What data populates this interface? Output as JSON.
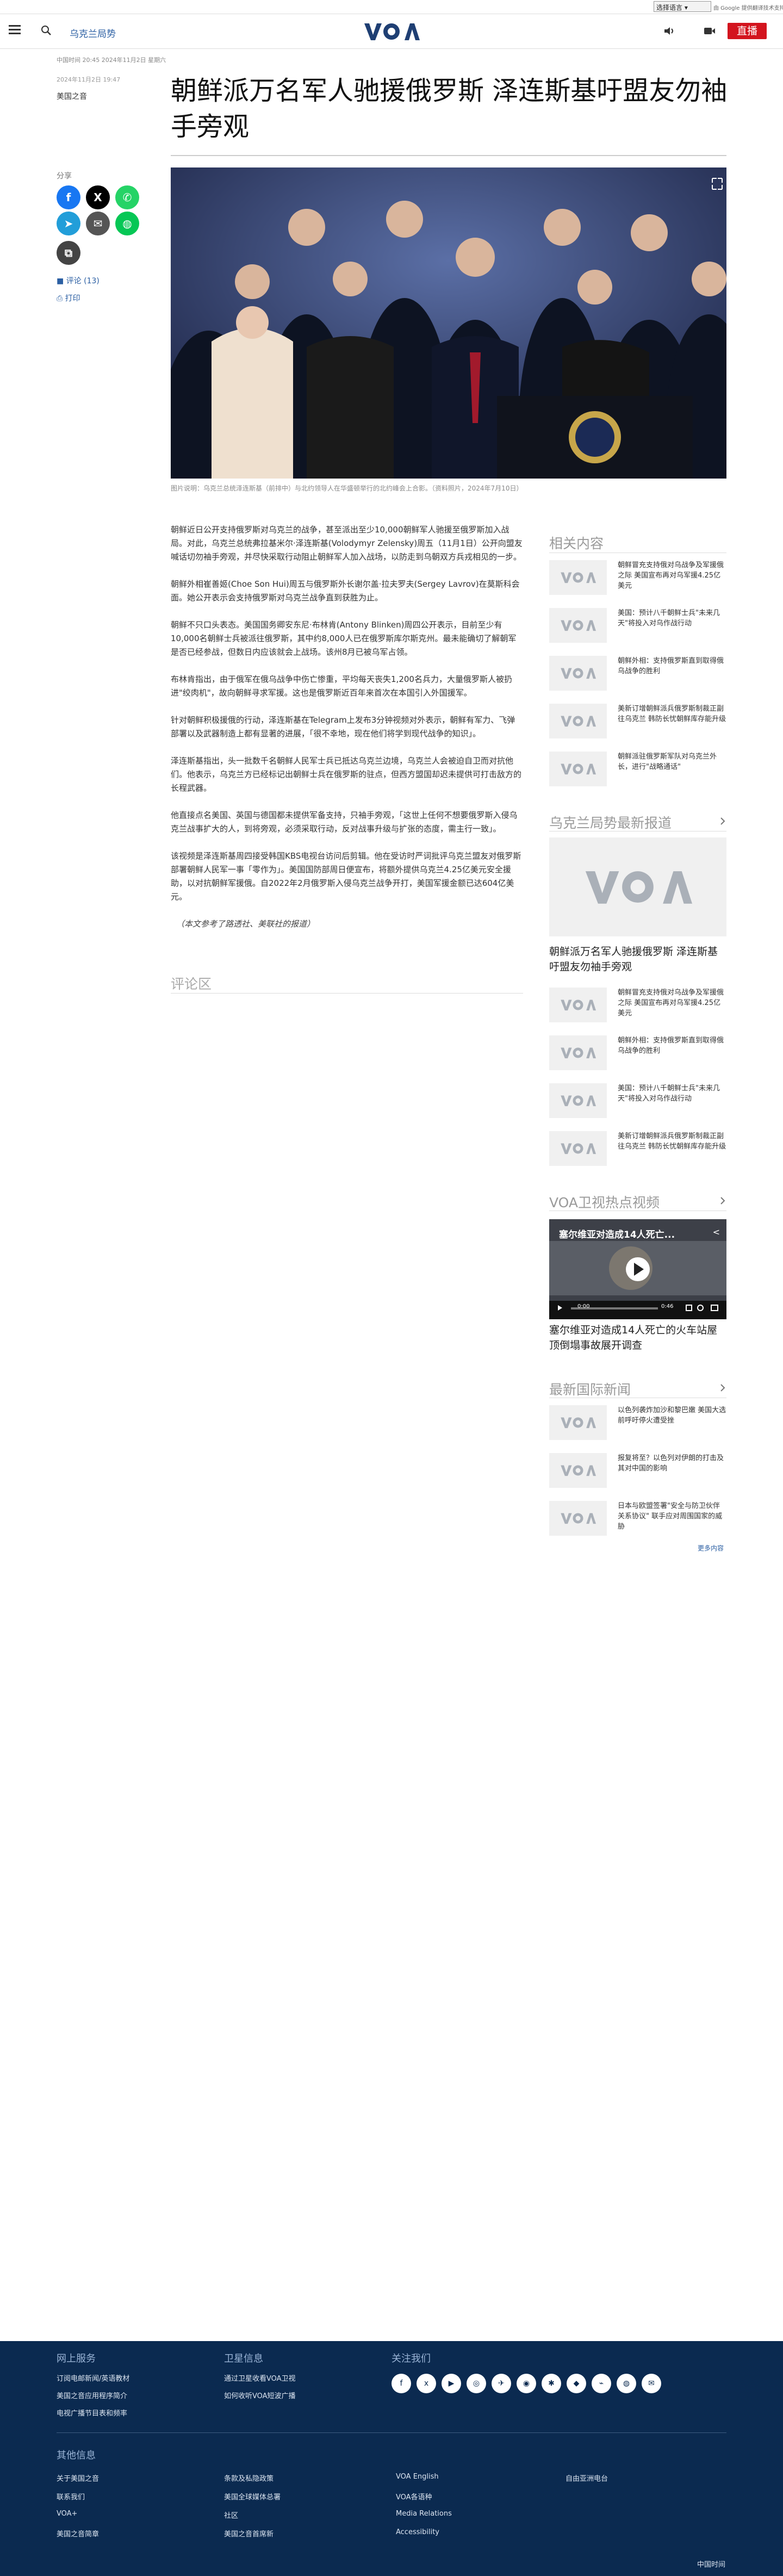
{
  "translate": {
    "select_label": "选择语言",
    "powered_by": "由 Google 提供翻译技术支持"
  },
  "header": {
    "section": "乌克兰局势",
    "live_label": "直播",
    "logo_text": "VOA"
  },
  "article": {
    "dateline": "中国时间 20:45 2024年11月2日 星期六",
    "published": "2024年11月2日 19:47",
    "author": "美国之音",
    "title": "朝鲜派万名军人驰援俄罗斯 泽连斯基吁盟友勿袖手旁观",
    "share_label": "分享",
    "comments_link": "评论 (13)",
    "print_link": "打印",
    "caption": "图片说明：乌克兰总统泽连斯基（前排中）与北约领导人在华盛顿举行的北约峰会上合影。（资料照片，2024年7月10日）",
    "paragraphs": [
      "朝鲜近日公开支持俄罗斯对乌克兰的战争，甚至派出至少10,000朝鲜军人驰援至俄罗斯加入战局。对此，乌克兰总统弗拉基米尔·泽连斯基(Volodymyr Zelensky)周五（11月1日）公开向盟友喊话切勿袖手旁观，并尽快采取行动阻止朝鲜军人加入战场，以防走到乌朝双方兵戎相见的一步。",
      "朝鲜外相崔善姬(Choe Son Hui)周五与俄罗斯外长谢尔盖·拉夫罗夫(Sergey Lavrov)在莫斯科会面。她公开表示会支持俄罗斯对乌克兰战争直到获胜为止。",
      "朝鲜不只口头表态。美国国务卿安东尼·布林肯(Antony Blinken)周四公开表示，目前至少有10,000名朝鲜士兵被派往俄罗斯，其中约8,000人已在俄罗斯库尔斯克州。最未能确切了解朝军是否已经参战，但数日内应该就会上战场。该州8月已被乌军占领。",
      "布林肯指出，由于俄军在俄乌战争中伤亡惨重，平均每天丧失1,200名兵力，大量俄罗斯人被扔进\"绞肉机\"，故向朝鲜寻求军援。这也是俄罗斯近百年来首次在本国引入外国援军。",
      "针对朝鲜积极援俄的行动，泽连斯基在Telegram上发布3分钟视频对外表示，朝鲜有军力、飞弹部署以及武器制造上都有显著的进展，「很不幸地，现在他们将学到现代战争的知识」。",
      "泽连斯基指出，头一批数千名朝鲜人民军士兵已抵达乌克兰边境，乌克兰人会被迫自卫而对抗他们。他表示，乌克兰方已经标记出朝鲜士兵在俄罗斯的驻点，但西方盟国却迟未提供可打击敌方的长程武器。",
      "他直接点名美国、英国与德国都未提供军备支持，只袖手旁观，「这世上任何不想要俄罗斯入侵乌克兰战事扩大的人，到将旁观，必须采取行动，反对战事升级与扩张的态度，需主行一致」。",
      "该视频是泽连斯基周四接受韩国KBS电视台访问后剪辑。他在受访时严词批评乌克兰盟友对俄罗斯部署朝鲜人民军一事「零作为」。美国国防部周日便宣布，将额外提供乌克兰4.25亿美元安全援助，以对抗朝鲜军援俄。自2022年2月俄罗斯入侵乌克兰战争开打，美国军援金额已达604亿美元。"
    ],
    "note": "（本文参考了路透社、美联社的报道）",
    "comments_heading": "评论区"
  },
  "sidebar": {
    "related_heading": "相关内容",
    "related": [
      "朝鲜冒充支持俄对乌战争及军援俄之际 美国宣布再对乌军援4.25亿美元",
      "美国：预计八千朝鲜士兵\"未来几天\"将投入对乌作战行动",
      "朝鲜外相：支持俄罗斯直到取得俄乌战争的胜利",
      "美新订增朝鲜派兵俄罗斯制裁正副往乌克兰 韩防长忧朝鲜库存能升级",
      "朝鲜派驻俄罗斯军队对乌克兰外长，进行\"战略通话\""
    ],
    "latest_heading": "乌克兰局势最新报道",
    "latest_title": "朝鲜派万名军人驰援俄罗斯 泽连斯基吁盟友勿袖手旁观",
    "latest": [
      "朝鲜冒充支持俄对乌战争及军援俄之际 美国宣布再对乌军援4.25亿美元",
      "朝鲜外相：支持俄罗斯直到取得俄乌战争的胜利",
      "美国：预计八千朝鲜士兵\"未来几天\"将投入对乌作战行动",
      "美新订增朝鲜派兵俄罗斯制裁正副往乌克兰 韩防长忧朝鲜库存能升级"
    ],
    "video_heading": "VOA卫视热点视频",
    "video_overlay": "塞尔维亚对造成14人死亡...",
    "video_time_current": "0:00",
    "video_time_total": "0:46",
    "video_title": "塞尔维亚对造成14人死亡的火车站屋顶倒塌事故展开调查",
    "world_heading": "最新国际新闻",
    "world": [
      "以色列袭炸加沙和黎巴嫩 美国大选前呼吁停火遭受挫",
      "报复将至？以色列对伊朗的打击及其对中国的影响",
      "日本与欧盟签署\"安全与防卫伙伴关系协议\" 联手应对周围国家的威胁"
    ],
    "more_label": "更多内容"
  },
  "footer": {
    "col1_heading": "网上服务",
    "col1_links": [
      "订阅电邮新闻/英语教材",
      "美国之音应用程序简介",
      "电视广播节目表和频率"
    ],
    "col2_heading": "卫星信息",
    "col2_links": [
      "通过卫星收看VOA卫视",
      "如何收听VOA短波广播"
    ],
    "col3_heading": "关注我们",
    "social": [
      "f",
      "x",
      "▶",
      "◎",
      "✈",
      "◉",
      "✱",
      "◆",
      "⌁",
      "◍",
      "✉"
    ],
    "other_heading": "其他信息",
    "links_col1": [
      "关于美国之音",
      "联系我们",
      "VOA+",
      "美国之音简章"
    ],
    "links_col2": [
      "条款及私隐政策",
      "美国全球媒体总署",
      "社区",
      "美国之音首席新"
    ],
    "links_col3": [
      "VOA English",
      "VOA各语种",
      "Media Relations",
      "Accessibility"
    ],
    "links_col4": [
      "自由亚洲电台"
    ],
    "lang_label": "中国时间"
  },
  "colors": {
    "brand": "#2b5fa3",
    "live": "#d3141e",
    "footer_bg": "#0b2a50",
    "facebook": "#1877f2",
    "x": "#000000",
    "whatsapp": "#25d366",
    "telegram": "#229ed9",
    "email": "#555555",
    "line": "#06c755",
    "copy": "#444444"
  }
}
